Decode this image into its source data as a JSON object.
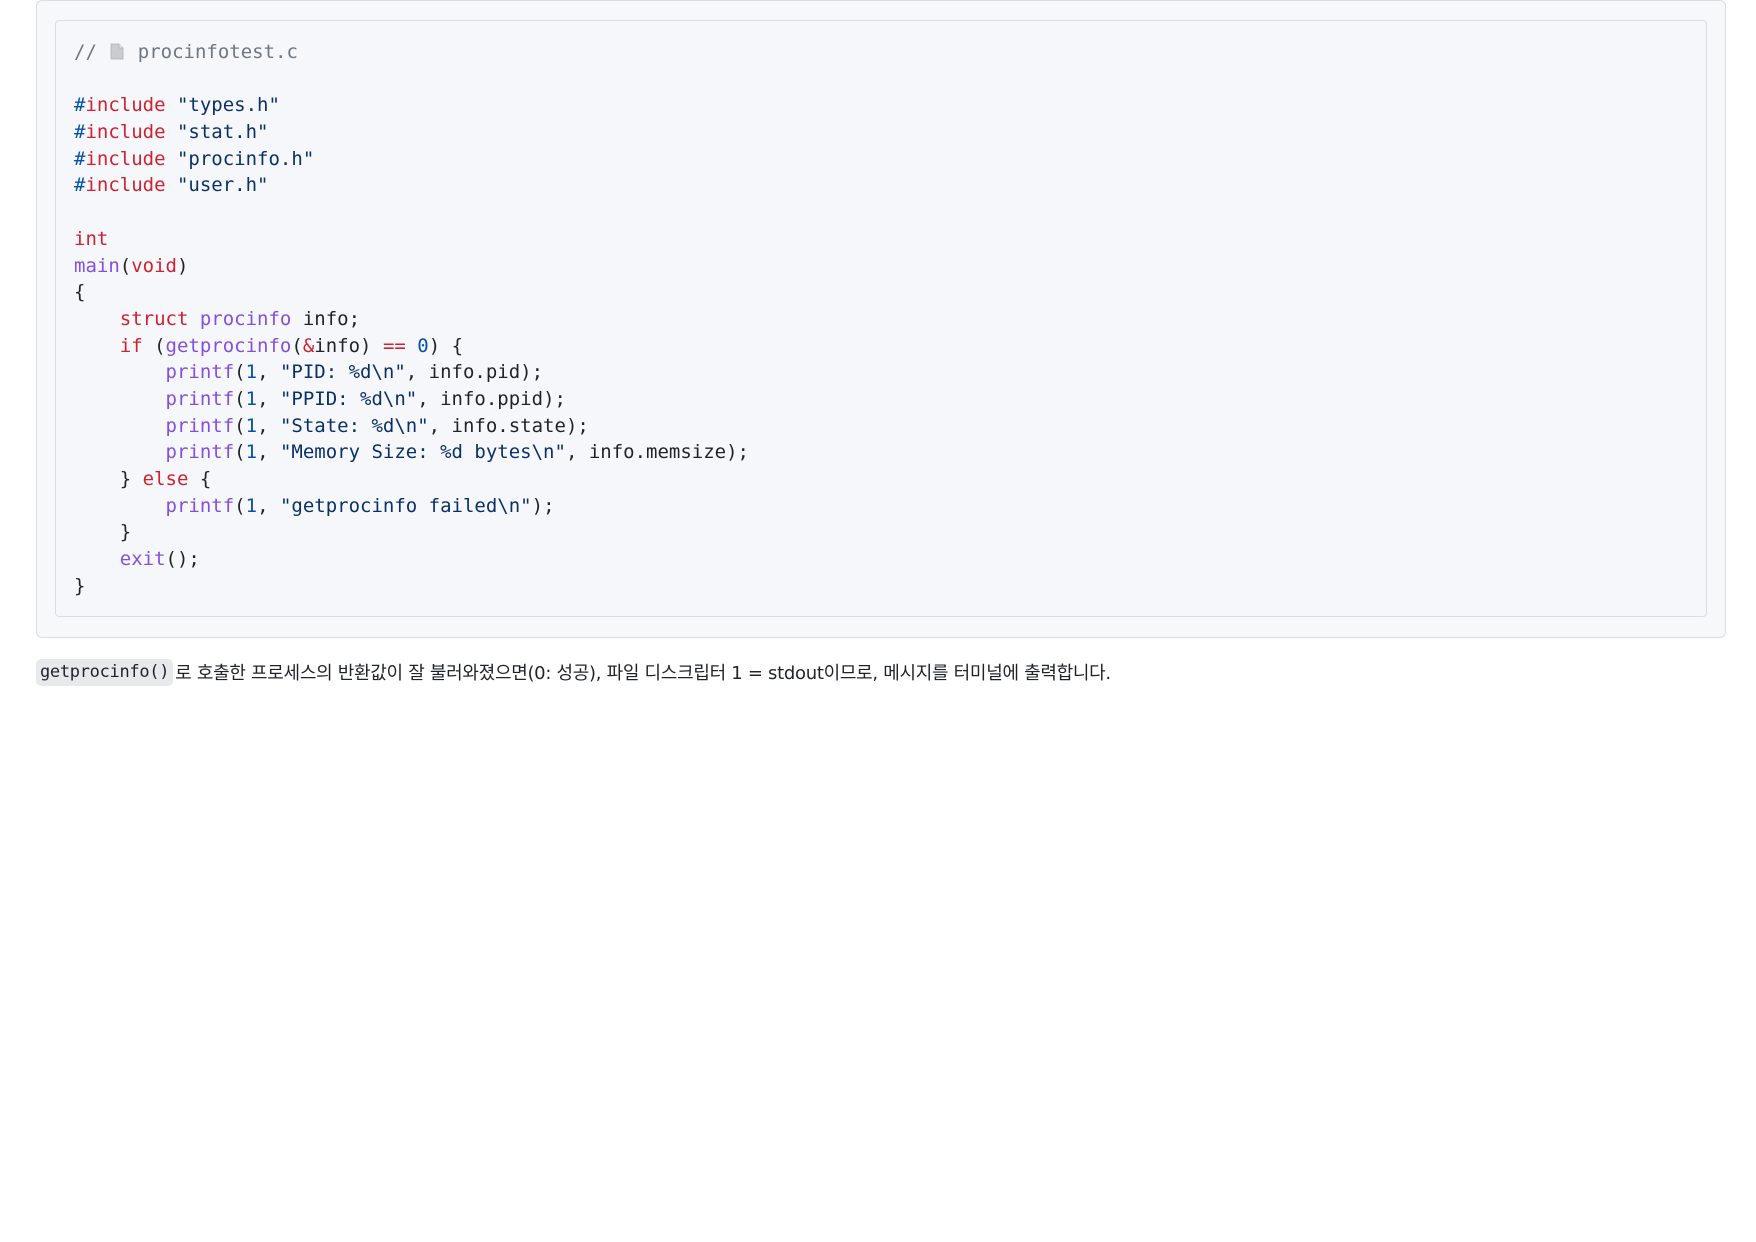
{
  "code": {
    "filename": "procinfotest.c",
    "icon": "file-icon",
    "colors": {
      "keyword": "#cf222e",
      "function": "#8250df",
      "string": "#0a3069",
      "number": "#0550ae",
      "comment": "#6e7781"
    },
    "lines": [
      [
        {
          "t": "// ",
          "c": "comment"
        },
        {
          "icon": "file"
        },
        {
          "t": " procinfotest.c",
          "c": "comment"
        }
      ],
      [],
      [
        {
          "t": "#",
          "c": "pp"
        },
        {
          "t": "include",
          "c": "kw"
        },
        {
          "t": " ",
          "c": "plain"
        },
        {
          "t": "\"types.h\"",
          "c": "str"
        }
      ],
      [
        {
          "t": "#",
          "c": "pp"
        },
        {
          "t": "include",
          "c": "kw"
        },
        {
          "t": " ",
          "c": "plain"
        },
        {
          "t": "\"stat.h\"",
          "c": "str"
        }
      ],
      [
        {
          "t": "#",
          "c": "pp"
        },
        {
          "t": "include",
          "c": "kw"
        },
        {
          "t": " ",
          "c": "plain"
        },
        {
          "t": "\"procinfo.h\"",
          "c": "str"
        }
      ],
      [
        {
          "t": "#",
          "c": "pp"
        },
        {
          "t": "include",
          "c": "kw"
        },
        {
          "t": " ",
          "c": "plain"
        },
        {
          "t": "\"user.h\"",
          "c": "str"
        }
      ],
      [],
      [
        {
          "t": "int",
          "c": "kw"
        }
      ],
      [
        {
          "t": "main",
          "c": "fn"
        },
        {
          "t": "(",
          "c": "plain"
        },
        {
          "t": "void",
          "c": "kw"
        },
        {
          "t": ")",
          "c": "plain"
        }
      ],
      [
        {
          "t": "{",
          "c": "plain"
        }
      ],
      [
        {
          "t": "    ",
          "c": "plain"
        },
        {
          "t": "struct",
          "c": "kw"
        },
        {
          "t": " ",
          "c": "plain"
        },
        {
          "t": "procinfo",
          "c": "fn"
        },
        {
          "t": " info;",
          "c": "plain"
        }
      ],
      [
        {
          "t": "    ",
          "c": "plain"
        },
        {
          "t": "if",
          "c": "kw"
        },
        {
          "t": " (",
          "c": "plain"
        },
        {
          "t": "getprocinfo",
          "c": "fn"
        },
        {
          "t": "(",
          "c": "plain"
        },
        {
          "t": "&",
          "c": "kw"
        },
        {
          "t": "info) ",
          "c": "plain"
        },
        {
          "t": "==",
          "c": "kw"
        },
        {
          "t": " ",
          "c": "plain"
        },
        {
          "t": "0",
          "c": "num"
        },
        {
          "t": ") {",
          "c": "plain"
        }
      ],
      [
        {
          "t": "        ",
          "c": "plain"
        },
        {
          "t": "printf",
          "c": "fn"
        },
        {
          "t": "(",
          "c": "plain"
        },
        {
          "t": "1",
          "c": "num"
        },
        {
          "t": ", ",
          "c": "plain"
        },
        {
          "t": "\"PID: %d\\n\"",
          "c": "str"
        },
        {
          "t": ", info.pid);",
          "c": "plain"
        }
      ],
      [
        {
          "t": "        ",
          "c": "plain"
        },
        {
          "t": "printf",
          "c": "fn"
        },
        {
          "t": "(",
          "c": "plain"
        },
        {
          "t": "1",
          "c": "num"
        },
        {
          "t": ", ",
          "c": "plain"
        },
        {
          "t": "\"PPID: %d\\n\"",
          "c": "str"
        },
        {
          "t": ", info.ppid);",
          "c": "plain"
        }
      ],
      [
        {
          "t": "        ",
          "c": "plain"
        },
        {
          "t": "printf",
          "c": "fn"
        },
        {
          "t": "(",
          "c": "plain"
        },
        {
          "t": "1",
          "c": "num"
        },
        {
          "t": ", ",
          "c": "plain"
        },
        {
          "t": "\"State: %d\\n\"",
          "c": "str"
        },
        {
          "t": ", info.state);",
          "c": "plain"
        }
      ],
      [
        {
          "t": "        ",
          "c": "plain"
        },
        {
          "t": "printf",
          "c": "fn"
        },
        {
          "t": "(",
          "c": "plain"
        },
        {
          "t": "1",
          "c": "num"
        },
        {
          "t": ", ",
          "c": "plain"
        },
        {
          "t": "\"Memory Size: %d bytes\\n\"",
          "c": "str"
        },
        {
          "t": ", info.memsize);",
          "c": "plain"
        }
      ],
      [
        {
          "t": "    } ",
          "c": "plain"
        },
        {
          "t": "else",
          "c": "kw"
        },
        {
          "t": " {",
          "c": "plain"
        }
      ],
      [
        {
          "t": "        ",
          "c": "plain"
        },
        {
          "t": "printf",
          "c": "fn"
        },
        {
          "t": "(",
          "c": "plain"
        },
        {
          "t": "1",
          "c": "num"
        },
        {
          "t": ", ",
          "c": "plain"
        },
        {
          "t": "\"getprocinfo failed\\n\"",
          "c": "str"
        },
        {
          "t": ");",
          "c": "plain"
        }
      ],
      [
        {
          "t": "    }",
          "c": "plain"
        }
      ],
      [
        {
          "t": "    ",
          "c": "plain"
        },
        {
          "t": "exit",
          "c": "fn"
        },
        {
          "t": "();",
          "c": "plain"
        }
      ],
      [
        {
          "t": "}",
          "c": "plain"
        }
      ]
    ]
  },
  "description": {
    "inline_code": "getprocinfo()",
    "text": "로 호출한 프로세스의 반환값이 잘 불러와졌으면(0: 성공), 파일 디스크립터 1 = stdout이므로, 메시지를 터미널에 출력합니다."
  }
}
